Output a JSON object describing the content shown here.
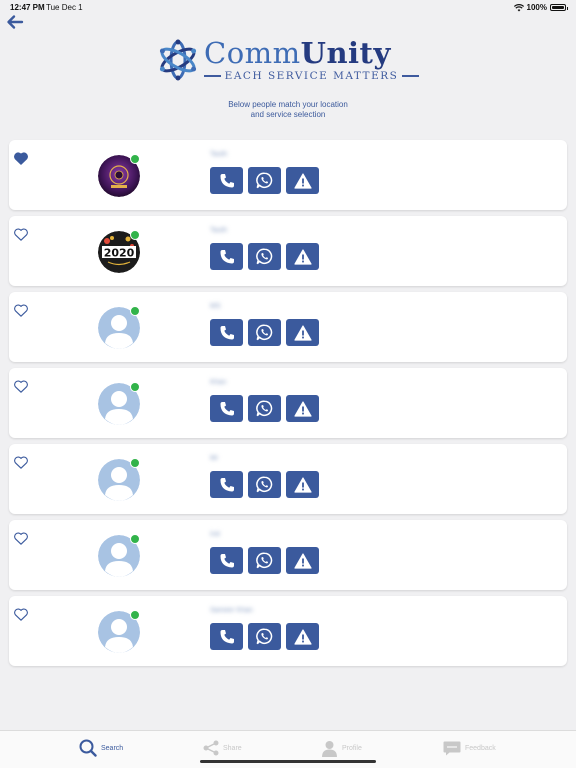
{
  "status_bar": {
    "time": "12:47 PM",
    "date": "Tue Dec 1",
    "battery": "100%"
  },
  "logo": {
    "title_part1": "Comm",
    "title_part2": "Unity",
    "tagline": "EACH SERVICE MATTERS"
  },
  "subtitle_line1": "Below people match your location",
  "subtitle_line2": "and service selection",
  "colors": {
    "accent": "#3b5a9d",
    "online": "#32b34a",
    "background": "#f0f0f2"
  },
  "providers": [
    {
      "name": "Tauth",
      "favorite": true,
      "avatar": "photo-dark-purple",
      "online": true
    },
    {
      "name": "Tauth",
      "favorite": false,
      "avatar": "photo-2020",
      "online": true
    },
    {
      "name": "MS",
      "favorite": false,
      "avatar": "default-person",
      "online": true
    },
    {
      "name": "Khan",
      "favorite": false,
      "avatar": "default-person",
      "online": true
    },
    {
      "name": "Mr",
      "favorite": false,
      "avatar": "default-person",
      "online": true
    },
    {
      "name": "Ind",
      "favorite": false,
      "avatar": "default-person",
      "online": true
    },
    {
      "name": "Sameer Khan",
      "favorite": false,
      "avatar": "default-person",
      "online": true
    }
  ],
  "tabs": [
    {
      "label": "Search",
      "icon": "search-icon",
      "active": true
    },
    {
      "label": "Share",
      "icon": "share-icon",
      "active": false
    },
    {
      "label": "Profile",
      "icon": "profile-icon",
      "active": false
    },
    {
      "label": "Feedback",
      "icon": "feedback-icon",
      "active": false
    }
  ]
}
